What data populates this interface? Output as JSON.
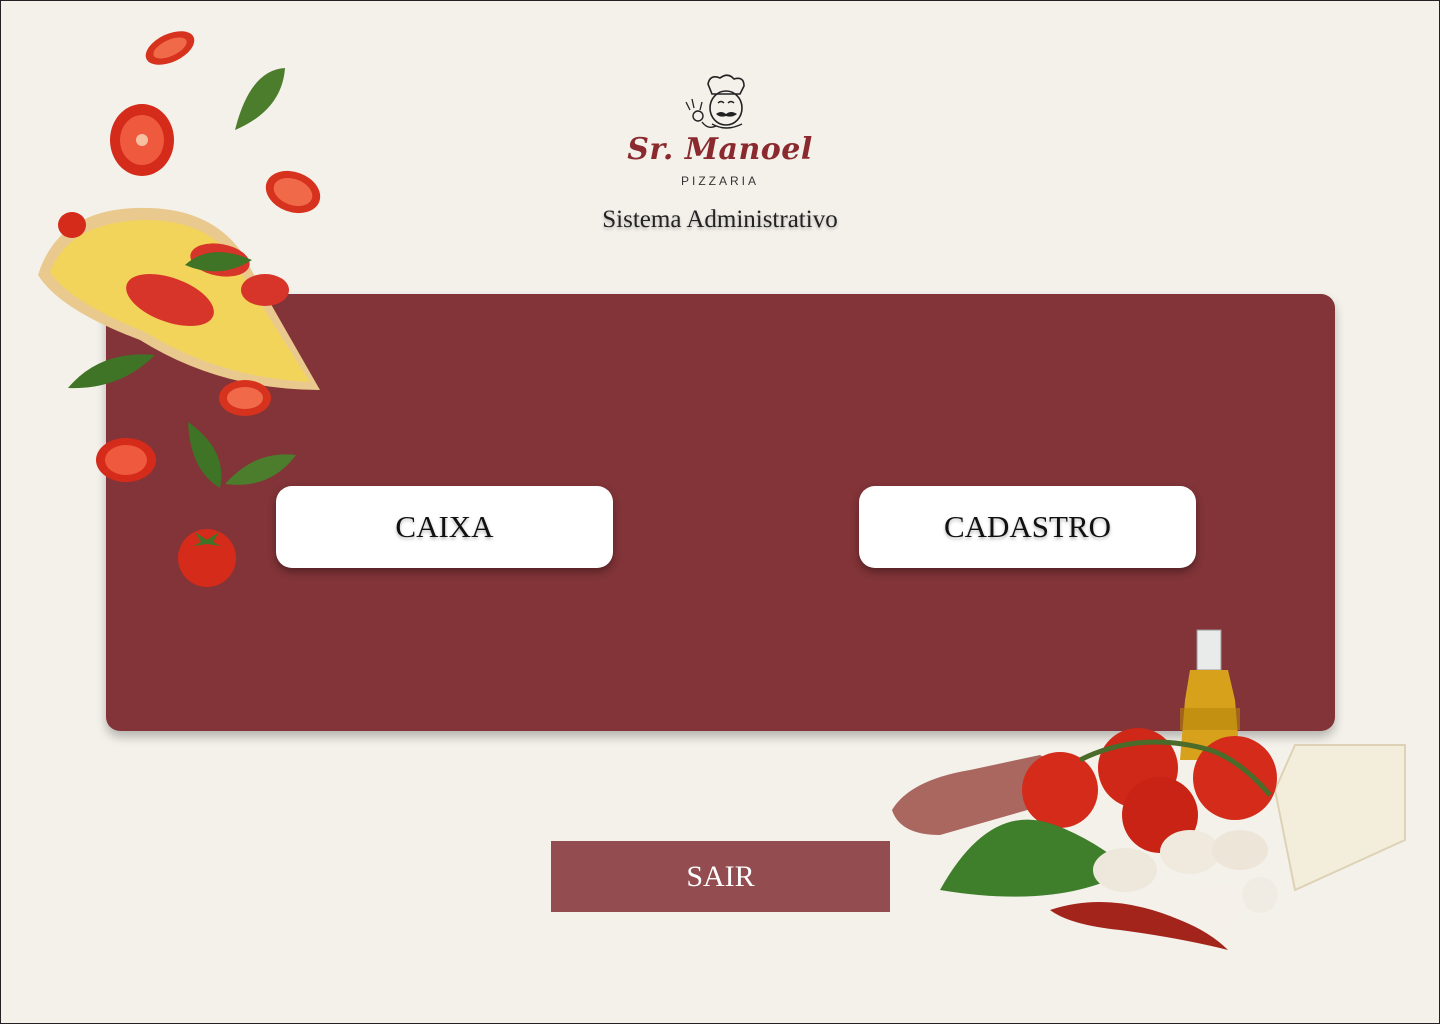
{
  "brand": {
    "name": "Sr. Manoel",
    "sub": "PIZZARIA",
    "accent": "#8a2a2e"
  },
  "header": {
    "subtitle": "Sistema Administrativo"
  },
  "menu": {
    "caixa_label": "CAIXA",
    "cadastro_label": "CADASTRO",
    "panel_color": "#823438"
  },
  "footer": {
    "sair_label": "SAIR",
    "sair_color": "#934c50"
  },
  "icons": {
    "logo": "chef-mascot-icon",
    "decor_left": "pizza-slice-with-tomatoes-and-basil",
    "decor_right": "ingredients-tomatoes-oil-cheese-salami"
  }
}
